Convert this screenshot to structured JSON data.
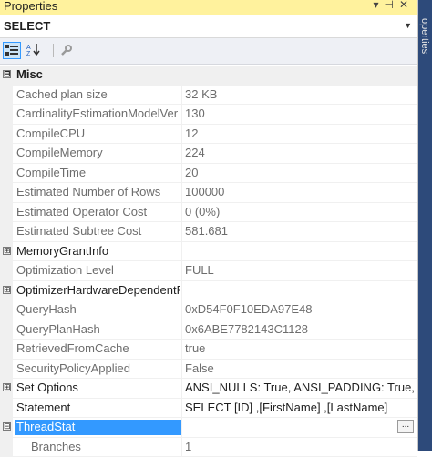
{
  "window": {
    "title": "Properties",
    "controls": [
      "▾",
      "⊣",
      "✕"
    ]
  },
  "object": {
    "name": "SELECT"
  },
  "toolbar": {
    "categorized": "categorized-view",
    "alphabetical": "alphabetical-view",
    "property_pages": "wrench"
  },
  "side_tab": {
    "label": "operties"
  },
  "rows": [
    {
      "type": "category",
      "expander": "⊟",
      "name": "Misc"
    },
    {
      "type": "prop",
      "name": "Cached plan size",
      "value": "32 KB",
      "dim": true
    },
    {
      "type": "prop",
      "name": "CardinalityEstimationModelVer",
      "value": "130",
      "dim": true
    },
    {
      "type": "prop",
      "name": "CompileCPU",
      "value": "12",
      "dim": true
    },
    {
      "type": "prop",
      "name": "CompileMemory",
      "value": "224",
      "dim": true
    },
    {
      "type": "prop",
      "name": "CompileTime",
      "value": "20",
      "dim": true
    },
    {
      "type": "prop",
      "name": "Estimated Number of Rows",
      "value": "100000",
      "dim": true
    },
    {
      "type": "prop",
      "name": "Estimated Operator Cost",
      "value": "0 (0%)",
      "dim": true
    },
    {
      "type": "prop",
      "name": "Estimated Subtree Cost",
      "value": "581.681",
      "dim": true
    },
    {
      "type": "group",
      "expander": "⊞",
      "name": "MemoryGrantInfo",
      "value": "",
      "dim": false
    },
    {
      "type": "prop",
      "name": "Optimization Level",
      "value": "FULL",
      "dim": true
    },
    {
      "type": "group",
      "expander": "⊞",
      "name": "OptimizerHardwareDependentP",
      "value": "",
      "dim": false
    },
    {
      "type": "prop",
      "name": "QueryHash",
      "value": "0xD54F0F10EDA97E48",
      "dim": true
    },
    {
      "type": "prop",
      "name": "QueryPlanHash",
      "value": "0x6ABE7782143C1128",
      "dim": true
    },
    {
      "type": "prop",
      "name": "RetrievedFromCache",
      "value": "true",
      "dim": true
    },
    {
      "type": "prop",
      "name": "SecurityPolicyApplied",
      "value": "False",
      "dim": true
    },
    {
      "type": "group",
      "expander": "⊞",
      "name": "Set Options",
      "value": "ANSI_NULLS: True, ANSI_PADDING: True, ANSI",
      "dim": false
    },
    {
      "type": "prop",
      "name": "Statement",
      "value": "SELECT [ID]      ,[FirstName]      ,[LastName]",
      "dim": false
    },
    {
      "type": "selected",
      "expander": "⊟",
      "name": "ThreadStat",
      "value": "",
      "ellipsis": "..."
    },
    {
      "type": "sub",
      "name": "Branches",
      "value": "1",
      "dim": true
    }
  ]
}
